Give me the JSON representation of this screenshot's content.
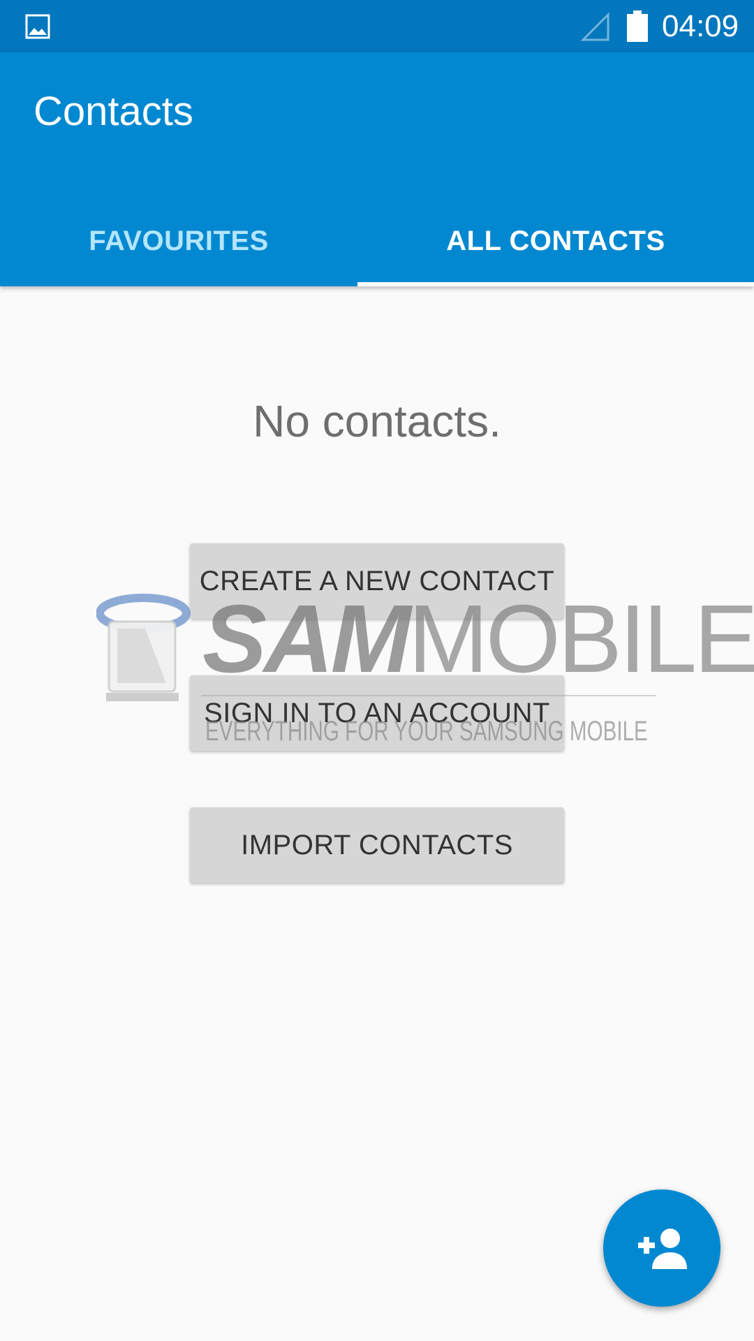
{
  "status_bar": {
    "time": "04:09",
    "icons": [
      "gallery-icon",
      "signal-icon",
      "battery-icon"
    ]
  },
  "app_bar": {
    "title": "Contacts",
    "tabs": [
      {
        "label": "FAVOURITES",
        "selected": false
      },
      {
        "label": "ALL CONTACTS",
        "selected": true
      }
    ]
  },
  "content": {
    "empty_message": "No contacts.",
    "buttons": {
      "create": "CREATE A NEW CONTACT",
      "sign_in": "SIGN IN TO AN ACCOUNT",
      "import": "IMPORT CONTACTS"
    }
  },
  "watermark": {
    "brand_bold": "SAM",
    "brand_light": "MOBILE",
    "tagline": "EVERYTHING FOR YOUR SAMSUNG MOBILE"
  },
  "fab": {
    "icon": "add-person-icon"
  },
  "colors": {
    "primary": "#0288d1",
    "primary_dark": "#0277bd",
    "background": "#fafafa",
    "button": "#d6d6d6"
  }
}
